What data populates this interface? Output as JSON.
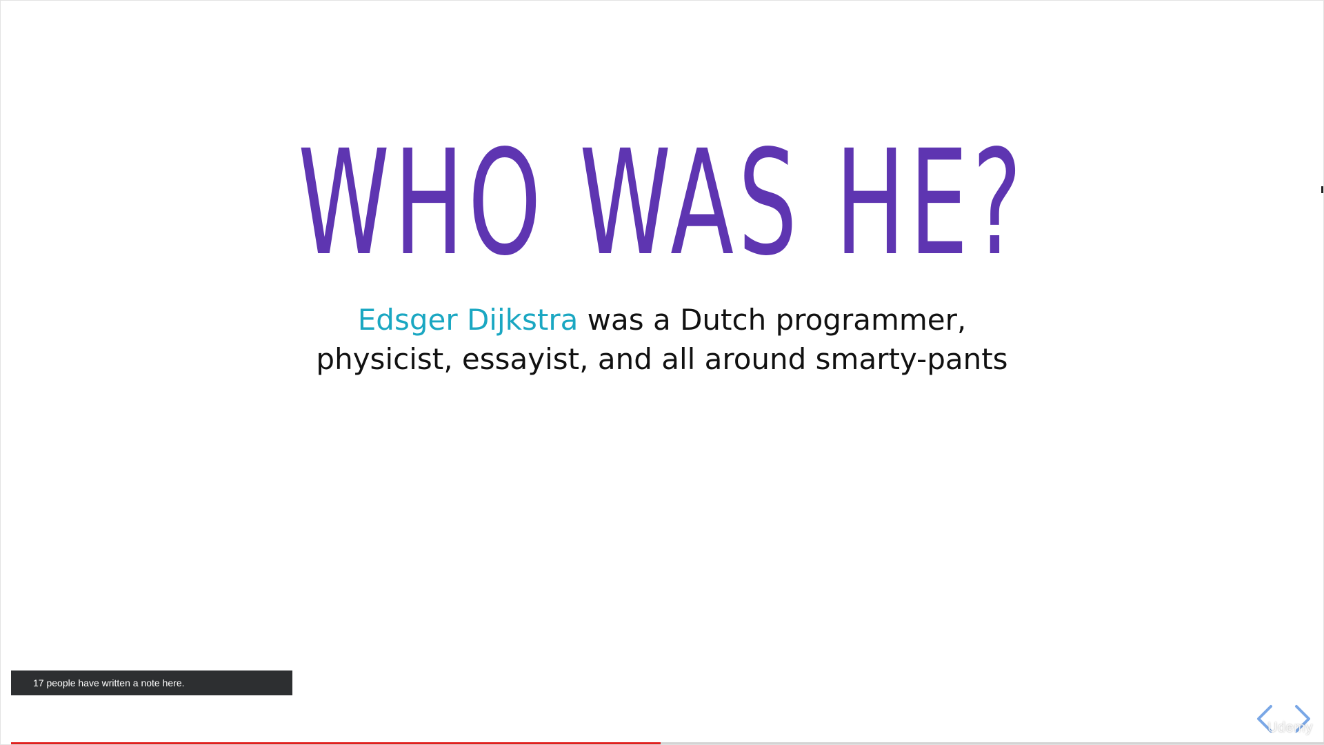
{
  "slide": {
    "title": "WHO WAS HE?",
    "body": {
      "highlight": "Edsger Dijkstra",
      "line1_rest": " was a Dutch programmer,",
      "line2": "physicist, essayist, and all around smarty-pants"
    }
  },
  "notes_banner": {
    "text": "17 people have written a note here."
  },
  "player": {
    "progress_fraction": 0.495,
    "prev_icon": "chevron-left-icon",
    "next_icon": "chevron-right-icon",
    "watermark": "Udemy"
  },
  "colors": {
    "title": "#5e35b1",
    "highlight": "#1aa7c2",
    "body_text": "#111111",
    "progress_fill": "#e0201e",
    "progress_track": "#d4d4d4",
    "arrow": "#7aa7e6",
    "banner_bg": "#2d2f31"
  }
}
